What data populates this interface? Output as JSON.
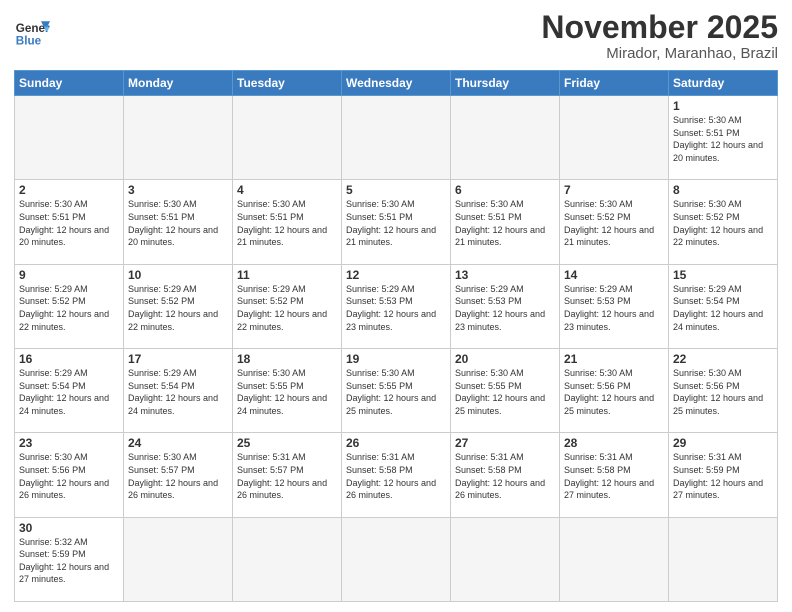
{
  "header": {
    "logo_line1": "General",
    "logo_line2": "Blue",
    "month": "November 2025",
    "location": "Mirador, Maranhao, Brazil"
  },
  "weekdays": [
    "Sunday",
    "Monday",
    "Tuesday",
    "Wednesday",
    "Thursday",
    "Friday",
    "Saturday"
  ],
  "days": {
    "d1": {
      "num": "1",
      "sunrise": "5:30 AM",
      "sunset": "5:51 PM",
      "daylight": "12 hours and 20 minutes."
    },
    "d2": {
      "num": "2",
      "sunrise": "5:30 AM",
      "sunset": "5:51 PM",
      "daylight": "12 hours and 20 minutes."
    },
    "d3": {
      "num": "3",
      "sunrise": "5:30 AM",
      "sunset": "5:51 PM",
      "daylight": "12 hours and 20 minutes."
    },
    "d4": {
      "num": "4",
      "sunrise": "5:30 AM",
      "sunset": "5:51 PM",
      "daylight": "12 hours and 21 minutes."
    },
    "d5": {
      "num": "5",
      "sunrise": "5:30 AM",
      "sunset": "5:51 PM",
      "daylight": "12 hours and 21 minutes."
    },
    "d6": {
      "num": "6",
      "sunrise": "5:30 AM",
      "sunset": "5:51 PM",
      "daylight": "12 hours and 21 minutes."
    },
    "d7": {
      "num": "7",
      "sunrise": "5:30 AM",
      "sunset": "5:52 PM",
      "daylight": "12 hours and 21 minutes."
    },
    "d8": {
      "num": "8",
      "sunrise": "5:30 AM",
      "sunset": "5:52 PM",
      "daylight": "12 hours and 22 minutes."
    },
    "d9": {
      "num": "9",
      "sunrise": "5:29 AM",
      "sunset": "5:52 PM",
      "daylight": "12 hours and 22 minutes."
    },
    "d10": {
      "num": "10",
      "sunrise": "5:29 AM",
      "sunset": "5:52 PM",
      "daylight": "12 hours and 22 minutes."
    },
    "d11": {
      "num": "11",
      "sunrise": "5:29 AM",
      "sunset": "5:52 PM",
      "daylight": "12 hours and 22 minutes."
    },
    "d12": {
      "num": "12",
      "sunrise": "5:29 AM",
      "sunset": "5:53 PM",
      "daylight": "12 hours and 23 minutes."
    },
    "d13": {
      "num": "13",
      "sunrise": "5:29 AM",
      "sunset": "5:53 PM",
      "daylight": "12 hours and 23 minutes."
    },
    "d14": {
      "num": "14",
      "sunrise": "5:29 AM",
      "sunset": "5:53 PM",
      "daylight": "12 hours and 23 minutes."
    },
    "d15": {
      "num": "15",
      "sunrise": "5:29 AM",
      "sunset": "5:54 PM",
      "daylight": "12 hours and 24 minutes."
    },
    "d16": {
      "num": "16",
      "sunrise": "5:29 AM",
      "sunset": "5:54 PM",
      "daylight": "12 hours and 24 minutes."
    },
    "d17": {
      "num": "17",
      "sunrise": "5:29 AM",
      "sunset": "5:54 PM",
      "daylight": "12 hours and 24 minutes."
    },
    "d18": {
      "num": "18",
      "sunrise": "5:30 AM",
      "sunset": "5:55 PM",
      "daylight": "12 hours and 24 minutes."
    },
    "d19": {
      "num": "19",
      "sunrise": "5:30 AM",
      "sunset": "5:55 PM",
      "daylight": "12 hours and 25 minutes."
    },
    "d20": {
      "num": "20",
      "sunrise": "5:30 AM",
      "sunset": "5:55 PM",
      "daylight": "12 hours and 25 minutes."
    },
    "d21": {
      "num": "21",
      "sunrise": "5:30 AM",
      "sunset": "5:56 PM",
      "daylight": "12 hours and 25 minutes."
    },
    "d22": {
      "num": "22",
      "sunrise": "5:30 AM",
      "sunset": "5:56 PM",
      "daylight": "12 hours and 25 minutes."
    },
    "d23": {
      "num": "23",
      "sunrise": "5:30 AM",
      "sunset": "5:56 PM",
      "daylight": "12 hours and 26 minutes."
    },
    "d24": {
      "num": "24",
      "sunrise": "5:30 AM",
      "sunset": "5:57 PM",
      "daylight": "12 hours and 26 minutes."
    },
    "d25": {
      "num": "25",
      "sunrise": "5:31 AM",
      "sunset": "5:57 PM",
      "daylight": "12 hours and 26 minutes."
    },
    "d26": {
      "num": "26",
      "sunrise": "5:31 AM",
      "sunset": "5:58 PM",
      "daylight": "12 hours and 26 minutes."
    },
    "d27": {
      "num": "27",
      "sunrise": "5:31 AM",
      "sunset": "5:58 PM",
      "daylight": "12 hours and 26 minutes."
    },
    "d28": {
      "num": "28",
      "sunrise": "5:31 AM",
      "sunset": "5:58 PM",
      "daylight": "12 hours and 27 minutes."
    },
    "d29": {
      "num": "29",
      "sunrise": "5:31 AM",
      "sunset": "5:59 PM",
      "daylight": "12 hours and 27 minutes."
    },
    "d30": {
      "num": "30",
      "sunrise": "5:32 AM",
      "sunset": "5:59 PM",
      "daylight": "12 hours and 27 minutes."
    }
  },
  "labels": {
    "sunrise": "Sunrise:",
    "sunset": "Sunset:",
    "daylight": "Daylight:"
  }
}
